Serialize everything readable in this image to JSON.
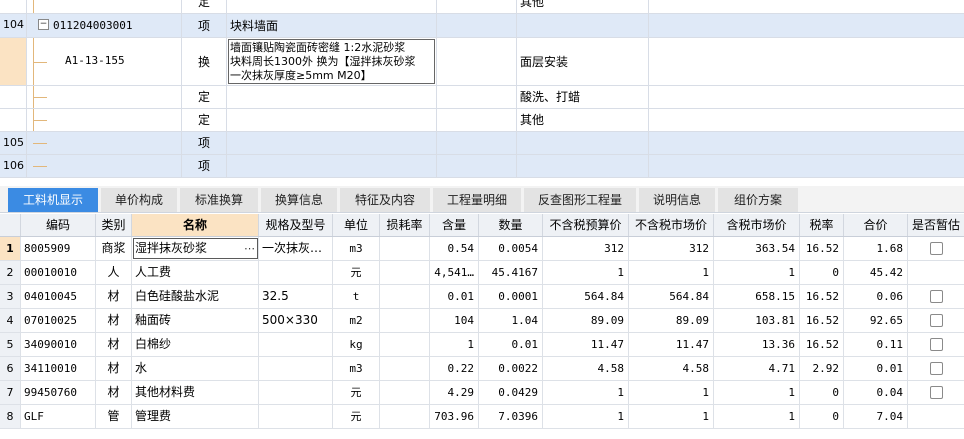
{
  "top_rows": [
    {
      "num": "",
      "code": "",
      "type": "定",
      "name": "",
      "c5": "其他"
    },
    {
      "num": "104",
      "code": "011204003001",
      "type": "项",
      "name": "块料墙面",
      "c5": ""
    },
    {
      "num": "",
      "code": "A1-13-155",
      "type": "换",
      "name_lines": [
        "墙面镶贴陶瓷面砖密缝 1:2水泥砂浆",
        "块料周长1300外  换为【湿拌抹灰砂浆",
        "一次抹灰厚度≥5mm M20】"
      ],
      "c5": "面层安装"
    },
    {
      "num": "",
      "code": "",
      "type": "定",
      "name": "",
      "c5": "酸洗、打蜡"
    },
    {
      "num": "",
      "code": "",
      "type": "定",
      "name": "",
      "c5": "其他"
    },
    {
      "num": "105",
      "code": "",
      "type": "项",
      "name": "",
      "c5": ""
    },
    {
      "num": "106",
      "code": "",
      "type": "项",
      "name": "",
      "c5": ""
    }
  ],
  "tabs": [
    "工料机显示",
    "单价构成",
    "标准换算",
    "换算信息",
    "特征及内容",
    "工程量明细",
    "反查图形工程量",
    "说明信息",
    "组价方案"
  ],
  "columns": [
    "编码",
    "类别",
    "名称",
    "规格及型号",
    "单位",
    "损耗率",
    "含量",
    "数量",
    "不含税预算价",
    "不含税市场价",
    "含税市场价",
    "税率",
    "合价",
    "是否暂估"
  ],
  "rows": [
    {
      "no": "1",
      "code": "8005909",
      "cat": "商浆",
      "name": "湿拌抹灰砂浆",
      "spec": "一次抹灰…",
      "unit": "m3",
      "loss": "",
      "content": "0.54",
      "qty": "0.0054",
      "p1": "312",
      "p2": "312",
      "p3": "363.54",
      "tax": "16.52",
      "total": "1.68",
      "chk": true
    },
    {
      "no": "2",
      "code": "00010010",
      "cat": "人",
      "name": "人工费",
      "spec": "",
      "unit": "元",
      "loss": "",
      "content": "4,541…",
      "qty": "45.4167",
      "p1": "1",
      "p2": "1",
      "p3": "1",
      "tax": "0",
      "total": "45.42",
      "chk": false
    },
    {
      "no": "3",
      "code": "04010045",
      "cat": "材",
      "name": "白色硅酸盐水泥",
      "spec": "32.5",
      "unit": "t",
      "loss": "",
      "content": "0.01",
      "qty": "0.0001",
      "p1": "564.84",
      "p2": "564.84",
      "p3": "658.15",
      "tax": "16.52",
      "total": "0.06",
      "chk": true
    },
    {
      "no": "4",
      "code": "07010025",
      "cat": "材",
      "name": "釉面砖",
      "spec": "500×330",
      "unit": "m2",
      "loss": "",
      "content": "104",
      "qty": "1.04",
      "p1": "89.09",
      "p2": "89.09",
      "p3": "103.81",
      "tax": "16.52",
      "total": "92.65",
      "chk": true
    },
    {
      "no": "5",
      "code": "34090010",
      "cat": "材",
      "name": "白棉纱",
      "spec": "",
      "unit": "kg",
      "loss": "",
      "content": "1",
      "qty": "0.01",
      "p1": "11.47",
      "p2": "11.47",
      "p3": "13.36",
      "tax": "16.52",
      "total": "0.11",
      "chk": true
    },
    {
      "no": "6",
      "code": "34110010",
      "cat": "材",
      "name": "水",
      "spec": "",
      "unit": "m3",
      "loss": "",
      "content": "0.22",
      "qty": "0.0022",
      "p1": "4.58",
      "p2": "4.58",
      "p3": "4.71",
      "tax": "2.92",
      "total": "0.01",
      "chk": true
    },
    {
      "no": "7",
      "code": "99450760",
      "cat": "材",
      "name": "其他材料费",
      "spec": "",
      "unit": "元",
      "loss": "",
      "content": "4.29",
      "qty": "0.0429",
      "p1": "1",
      "p2": "1",
      "p3": "1",
      "tax": "0",
      "total": "0.04",
      "chk": true
    },
    {
      "no": "8",
      "code": "GLF",
      "cat": "管",
      "name": "管理费",
      "spec": "",
      "unit": "元",
      "loss": "",
      "content": "703.96",
      "qty": "7.0396",
      "p1": "1",
      "p2": "1",
      "p3": "1",
      "tax": "0",
      "total": "7.04",
      "chk": false
    }
  ],
  "colors": {
    "accent_tab": "#3b8be3",
    "selected_row": "#fbe3c3",
    "blue_row": "#dfe9f7",
    "tree_line": "#e2b77b"
  }
}
